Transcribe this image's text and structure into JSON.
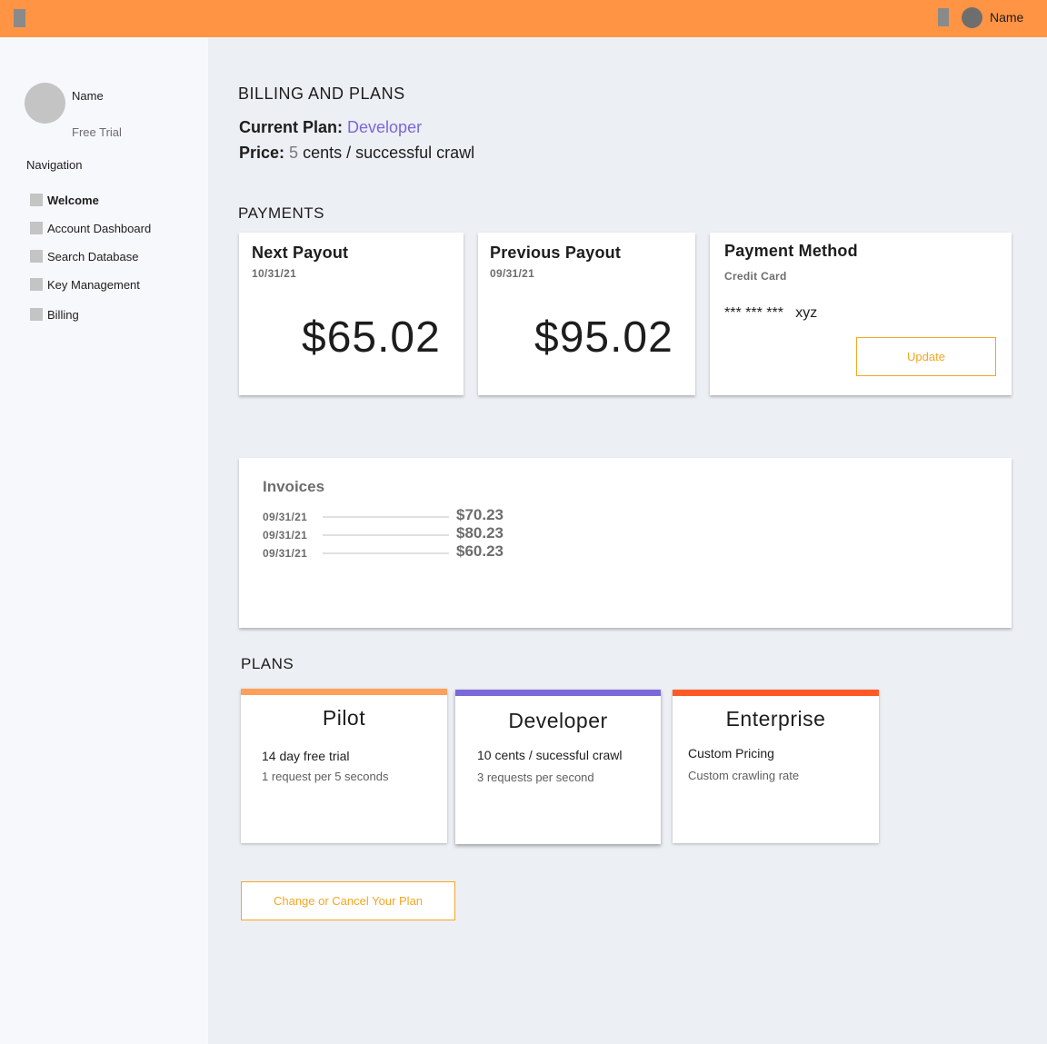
{
  "topbar": {
    "user_name": "Name"
  },
  "sidebar": {
    "profile_name": "Name",
    "profile_plan": "Free Trial",
    "nav_heading": "Navigation",
    "items": [
      {
        "label": "Welcome",
        "active": true
      },
      {
        "label": "Account Dashboard"
      },
      {
        "label": "Search Database"
      },
      {
        "label": "Key Management"
      },
      {
        "label": "Billing"
      }
    ]
  },
  "main": {
    "title": "BILLING AND PLANS",
    "current_plan_label": "Current Plan:",
    "current_plan_value": "Developer",
    "price_label": "Price:",
    "price_value": "5",
    "price_unit": "cents / successful crawl"
  },
  "payments": {
    "title": "PAYMENTS",
    "next_payout": {
      "title": "Next Payout",
      "date": "10/31/21",
      "amount": "$65.02"
    },
    "previous_payout": {
      "title": "Previous Payout",
      "date": "09/31/21",
      "amount": "$95.02"
    },
    "payment_method": {
      "title": "Payment Method",
      "type": "Credit Card",
      "masked": "*** *** ***",
      "suffix": "xyz",
      "update_label": "Update"
    }
  },
  "invoices": {
    "title": "Invoices",
    "rows": [
      {
        "date": "09/31/21",
        "amount": "$70.23"
      },
      {
        "date": "09/31/21",
        "amount": "$80.23"
      },
      {
        "date": "09/31/21",
        "amount": "$60.23"
      }
    ]
  },
  "plans": {
    "title": "PLANS",
    "items": [
      {
        "name": "Pilot",
        "line1": "14 day free trial",
        "line2": "1 request per 5 seconds",
        "color": "#ffa05a"
      },
      {
        "name": "Developer",
        "line1": "10 cents / sucessful crawl",
        "line2": "3 requests per second",
        "color": "#7b68d9"
      },
      {
        "name": "Enterprise",
        "line1": "Custom Pricing",
        "line2": "Custom crawling rate",
        "color": "#ff5a26"
      }
    ],
    "change_button": "Change or Cancel Your Plan"
  },
  "colors": {
    "topbar": "#ff9444",
    "accent": "#7b68d9",
    "button": "#f5a623"
  }
}
